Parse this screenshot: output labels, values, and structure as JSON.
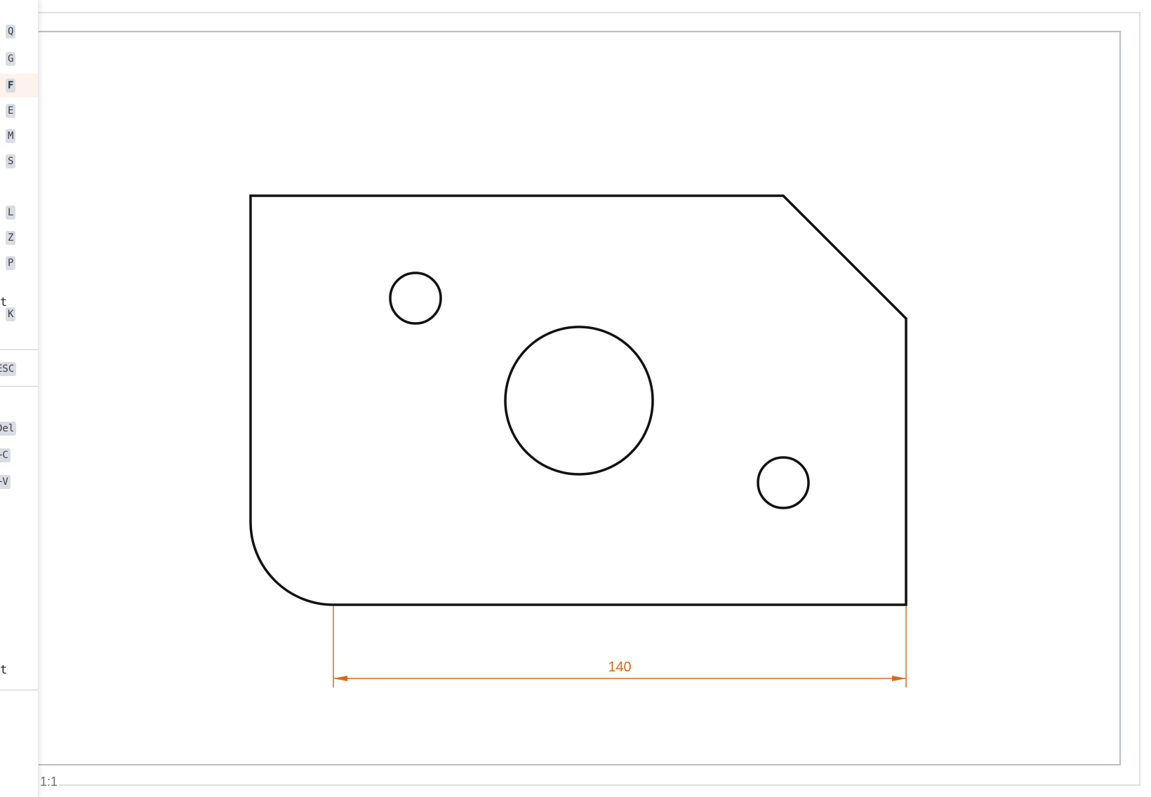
{
  "sidebar": {
    "shortcuts": [
      {
        "key": "Q",
        "active": false
      },
      {
        "key": "G",
        "active": false
      },
      {
        "key": "F",
        "active": true
      },
      {
        "key": "E",
        "active": false
      },
      {
        "key": "M",
        "active": false
      },
      {
        "key": "S",
        "active": false
      },
      {
        "key": "L",
        "active": false
      },
      {
        "key": "Z",
        "active": false
      },
      {
        "key": "P",
        "active": false
      },
      {
        "key": "K",
        "active": false
      },
      {
        "key": "ESC",
        "active": false
      },
      {
        "key": "Del",
        "active": false
      },
      {
        "key": "+C",
        "active": false
      },
      {
        "key": "+V",
        "active": false
      }
    ],
    "trailing_texts": [
      "t",
      "t"
    ]
  },
  "canvas": {
    "scale_label": "1:1",
    "dimension": {
      "value": "140"
    },
    "colors": {
      "part_outline": "#111111",
      "dimension": "#d96b1a",
      "frame": "#b8bcc6"
    }
  }
}
